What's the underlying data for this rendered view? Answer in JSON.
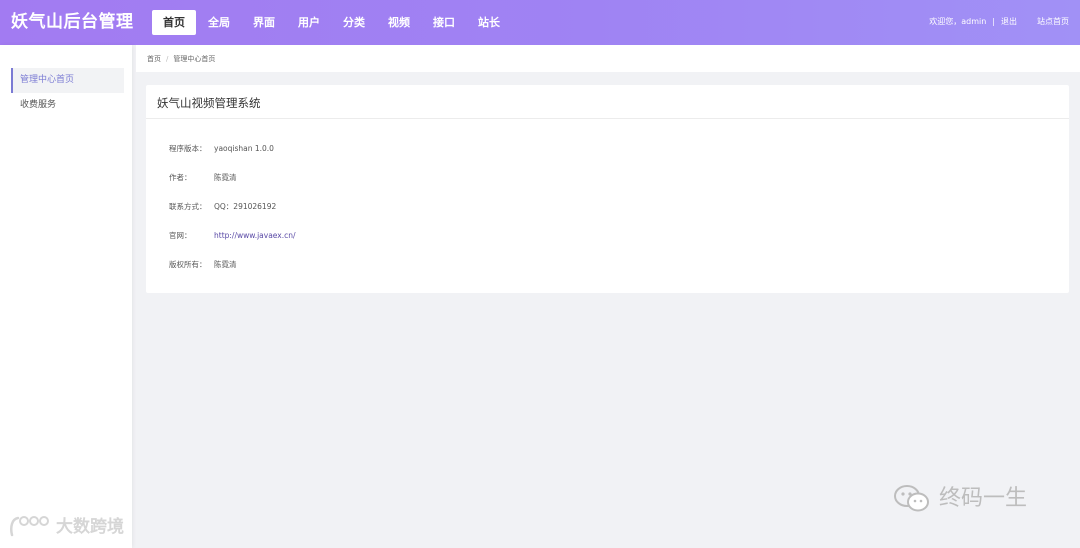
{
  "header": {
    "brand": "妖气山后台管理",
    "nav": [
      {
        "label": "首页",
        "active": true
      },
      {
        "label": "全局",
        "active": false
      },
      {
        "label": "界面",
        "active": false
      },
      {
        "label": "用户",
        "active": false
      },
      {
        "label": "分类",
        "active": false
      },
      {
        "label": "视频",
        "active": false
      },
      {
        "label": "接口",
        "active": false
      },
      {
        "label": "站长",
        "active": false
      }
    ],
    "welcome": "欢迎您，admin",
    "separator": "|",
    "logout": "退出",
    "site_home": "站点首页"
  },
  "sidebar": {
    "items": [
      {
        "label": "管理中心首页",
        "active": true
      },
      {
        "label": "收费服务",
        "active": false
      }
    ]
  },
  "breadcrumb": {
    "home": "首页",
    "divider": "/",
    "current": "管理中心首页"
  },
  "panel": {
    "title": "妖气山视频管理系统",
    "rows": [
      {
        "label": "程序版本：",
        "value": "yaoqishan 1.0.0",
        "link": false
      },
      {
        "label": "作者：",
        "value": "陈霓清",
        "link": false
      },
      {
        "label": "联系方式：",
        "value": "QQ：291026192",
        "link": false
      },
      {
        "label": "官网：",
        "value": "http://www.javaex.cn/",
        "link": true
      },
      {
        "label": "版权所有：",
        "value": "陈霓清",
        "link": false
      }
    ]
  },
  "watermarks": {
    "right_text": "终码一生",
    "right_icon": "wechat-icon",
    "left_text": "大数跨境",
    "left_icon": "logo-icon"
  },
  "colors": {
    "header_start": "#a27bf2",
    "header_end": "#a191f6",
    "accent": "#7b7bd4",
    "link": "#5a4aa6",
    "page_bg": "#f1f2f5"
  }
}
